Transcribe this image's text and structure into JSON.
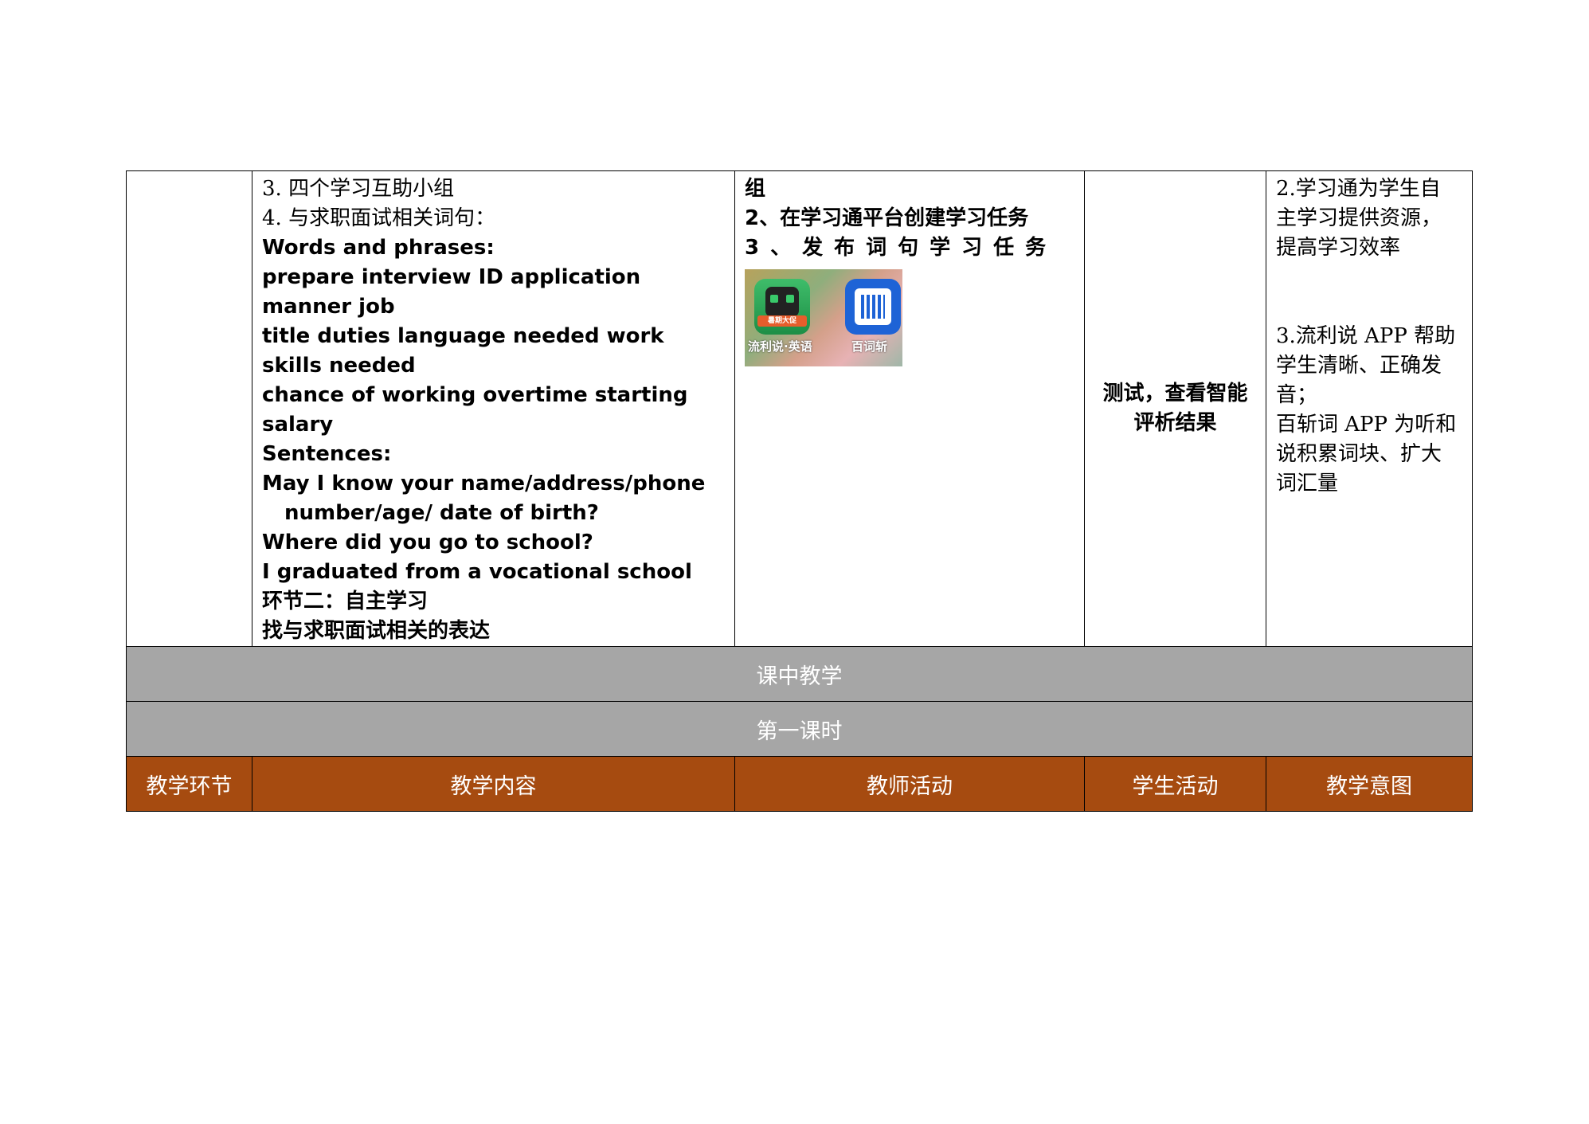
{
  "row": {
    "content_lines": [
      "3. 四个学习互助小组",
      "4. 与求职面试相关词句：",
      "Words and phrases:",
      "prepare interview ID application manner job",
      "title duties language needed work skills needed",
      "chance of working overtime starting salary",
      "Sentences:",
      "May I know your name/address/phone",
      "number/age/ date of birth?",
      "Where did you go to school?",
      "I graduated from a vocational school",
      "环节二：自主学习",
      "找与求职面试相关的表达"
    ],
    "teacher_lines": [
      "组",
      "2、在学习通平台创建学习任务",
      "3、发布词句学习任务"
    ],
    "apps": {
      "app1_banner": "暑期大促",
      "app1_label": "流利说·英语",
      "app2_label": "百词斩",
      "app1_icon": "liulishuo-app-icon",
      "app2_icon": "baicizhan-app-icon"
    },
    "student_activity": [
      "测试，查看智能",
      "评析结果"
    ],
    "intent_lines": [
      "2.学习通为学生自",
      "主学习提供资源，",
      "提高学习效率",
      "3.流利说 APP 帮助",
      "学生清晰、正确发",
      "音；",
      "百斩词 APP 为听和",
      "说积累词块、扩大",
      "词汇量"
    ]
  },
  "bands": {
    "section": "课中教学",
    "period": "第一课时"
  },
  "header": {
    "col1": "教学环节",
    "col2": "教学内容",
    "col3": "教师活动",
    "col4": "学生活动",
    "col5": "教学意图"
  },
  "colors": {
    "band_gray": "#a6a6a6",
    "header_brown": "#a64b10"
  }
}
